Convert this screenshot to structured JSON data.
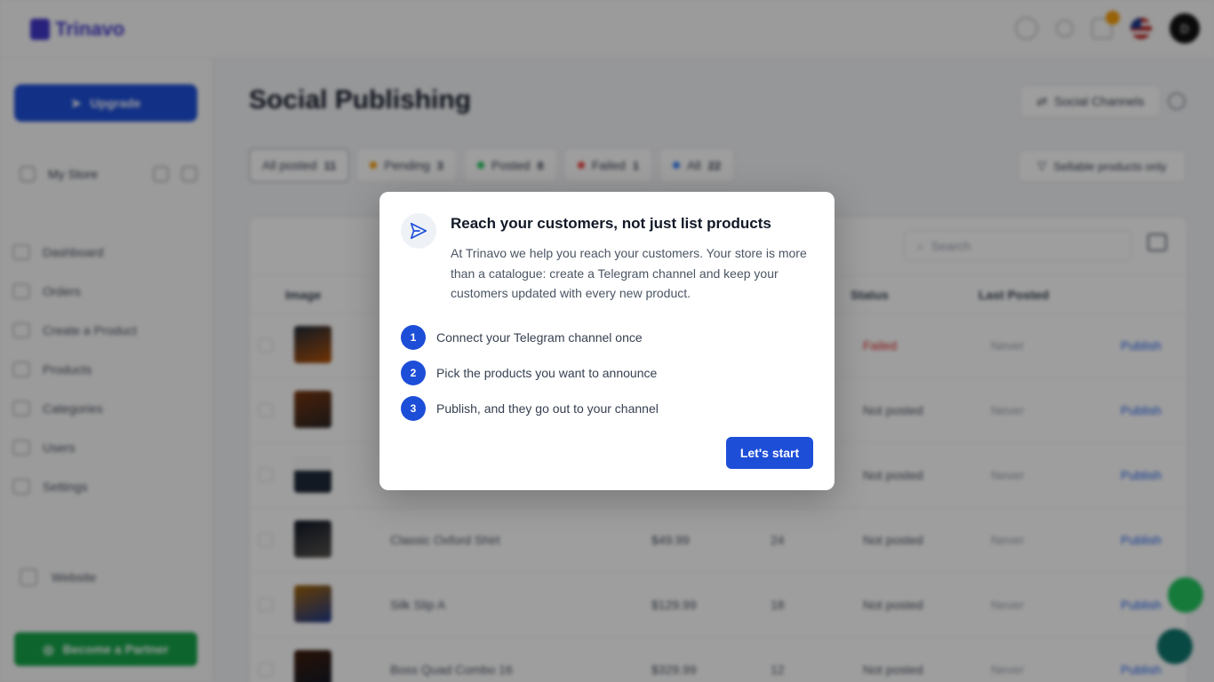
{
  "app": {
    "brand": "Trinavo",
    "avatar_initial": "D"
  },
  "sidebar": {
    "upgrade_label": "Upgrade",
    "store_name": "My Store",
    "items": [
      {
        "label": "Dashboard"
      },
      {
        "label": "Orders"
      },
      {
        "label": "Create a Product"
      },
      {
        "label": "Products"
      },
      {
        "label": "Categories"
      },
      {
        "label": "Users"
      },
      {
        "label": "Settings"
      }
    ],
    "website_label": "Website",
    "partner_label": "Become a Partner"
  },
  "page": {
    "title": "Social Publishing",
    "channels_label": "Social Channels",
    "sellable_label": "Sellable products only",
    "search_placeholder": "Search",
    "filters": [
      {
        "label": "All posted",
        "count": "11",
        "color": ""
      },
      {
        "label": "Pending",
        "count": "3",
        "color": "#f59e0b"
      },
      {
        "label": "Posted",
        "count": "8",
        "color": "#22c55e"
      },
      {
        "label": "Failed",
        "count": "1",
        "color": "#ef4444"
      },
      {
        "label": "All",
        "count": "22",
        "color": "#3b82f6"
      }
    ],
    "columns": {
      "image": "Image",
      "status": "Status",
      "last_posted": "Last Posted"
    },
    "rows": [
      {
        "name": "",
        "price": "",
        "stock": "",
        "status": "Failed",
        "last": "Never",
        "action": "Publish"
      },
      {
        "name": "",
        "price": "",
        "stock": "",
        "status": "Not posted",
        "last": "Never",
        "action": "Publish"
      },
      {
        "name": "",
        "price": "",
        "stock": "",
        "status": "Not posted",
        "last": "Never",
        "action": "Publish"
      },
      {
        "name": "Classic Oxford Shirt",
        "price": "$49.99",
        "stock": "24",
        "status": "Not posted",
        "last": "Never",
        "action": "Publish"
      },
      {
        "name": "Silk Slip A",
        "price": "$129.99",
        "stock": "18",
        "status": "Not posted",
        "last": "Never",
        "action": "Publish"
      },
      {
        "name": "Boss Quad Combo 16",
        "price": "$329.99",
        "stock": "12",
        "status": "Not posted",
        "last": "Never",
        "action": "Publish"
      }
    ]
  },
  "modal": {
    "title": "Reach your customers, not just list products",
    "description": "At Trinavo we help you reach your customers. Your store is more than a catalogue: create a Telegram channel and keep your customers updated with every new product.",
    "steps": [
      {
        "number": "1",
        "text": "Connect your Telegram channel once"
      },
      {
        "number": "2",
        "text": "Pick the products you want to announce"
      },
      {
        "number": "3",
        "text": "Publish, and they go out to your channel"
      }
    ],
    "cta_label": "Let's start"
  },
  "colors": {
    "primary": "#1d4ed8",
    "partner": "#16a34a"
  }
}
